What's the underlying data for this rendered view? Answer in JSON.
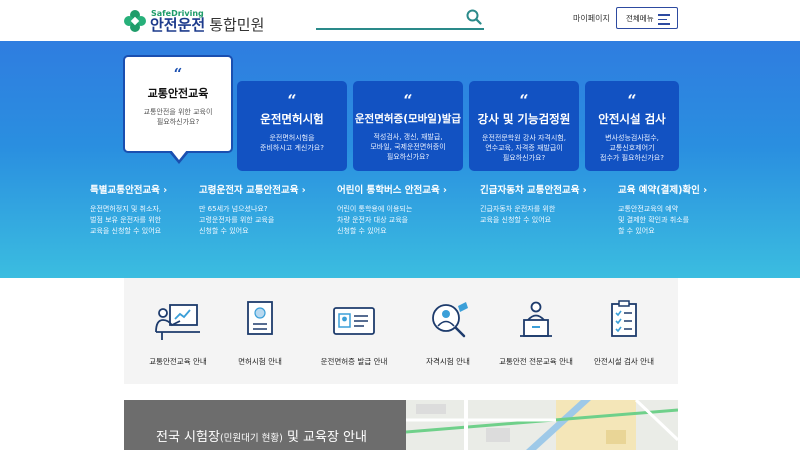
{
  "header": {
    "logo_en": "SafeDriving",
    "logo_ko": "안전운전",
    "logo_sub": "통합민원",
    "mypage": "마이페이지",
    "menu": "전체메뉴"
  },
  "colors": {
    "brand_green": "#1f9c6a",
    "brand_blue": "#1d3b8c",
    "card_blue": "#1252c2",
    "hero_top": "#2f7de0",
    "hero_bottom": "#3bbde0"
  },
  "hero": {
    "active_card": {
      "quote": "“",
      "title": "교통안전교육",
      "desc1": "교통안전을 위한 교육이",
      "desc2": "필요하신가요?"
    },
    "cards": [
      {
        "quote": "“",
        "title": "운전면허시험",
        "lines": [
          "운전면허시험을",
          "준비하시고 계신가요?"
        ]
      },
      {
        "quote": "“",
        "title": "운전면허증(모바일)발급",
        "lines": [
          "적성검사, 갱신, 재발급,",
          "모바일, 국제운전면허증이",
          "필요하신가요?"
        ]
      },
      {
        "quote": "“",
        "title": "강사 및 기능검정원",
        "lines": [
          "운전전문학원 강사 자격시험,",
          "연수교육, 자격증 재발급이",
          "필요하신가요?"
        ]
      },
      {
        "quote": "“",
        "title": "안전시설 검사",
        "lines": [
          "변사성능검사접수,",
          "교통신호제어기",
          "접수가 필요하신가요?"
        ]
      }
    ],
    "subs": [
      {
        "title": "특별교통안전교육 ›",
        "lines": [
          "운전면허정지 및 취소자,",
          "벌점 보유 운전자를 위한",
          "교육을 신청할 수 있어요"
        ]
      },
      {
        "title": "고령운전자 교통안전교육 ›",
        "lines": [
          "만 65세가 넘으셨나요?",
          "고령운전자를 위한 교육을",
          "신청할 수 있어요"
        ]
      },
      {
        "title": "어린이 통학버스 안전교육 ›",
        "lines": [
          "어린이 통학용에 이용되는",
          "차량 운전자 대상 교육을",
          "신청할 수 있어요"
        ]
      },
      {
        "title": "긴급자동차 교통안전교육 ›",
        "lines": [
          "긴급자동차 운전자를 위한",
          "교육을 신청할 수 있어요"
        ]
      },
      {
        "title": "교육 예약(결제)확인 ›",
        "lines": [
          "교통안전교육의 예약",
          "및 결제한 확인과 취소를",
          "할 수 있어요"
        ]
      }
    ]
  },
  "quick_links": [
    {
      "label": "교통안전교육 안내",
      "icon": "presentation-icon"
    },
    {
      "label": "면허시험 안내",
      "icon": "license-doc-icon"
    },
    {
      "label": "운전면허증 발급 안내",
      "icon": "id-card-icon"
    },
    {
      "label": "자격시험 안내",
      "icon": "certificate-search-icon"
    },
    {
      "label": "교통안전 전문교육 안내",
      "icon": "lecture-icon"
    },
    {
      "label": "안전시설 검사 안내",
      "icon": "checklist-icon"
    }
  ],
  "bottom": {
    "title_main": "전국 시험장",
    "title_small": "(민원대기 현황)",
    "title_rest": " 및 교육장 안내"
  }
}
